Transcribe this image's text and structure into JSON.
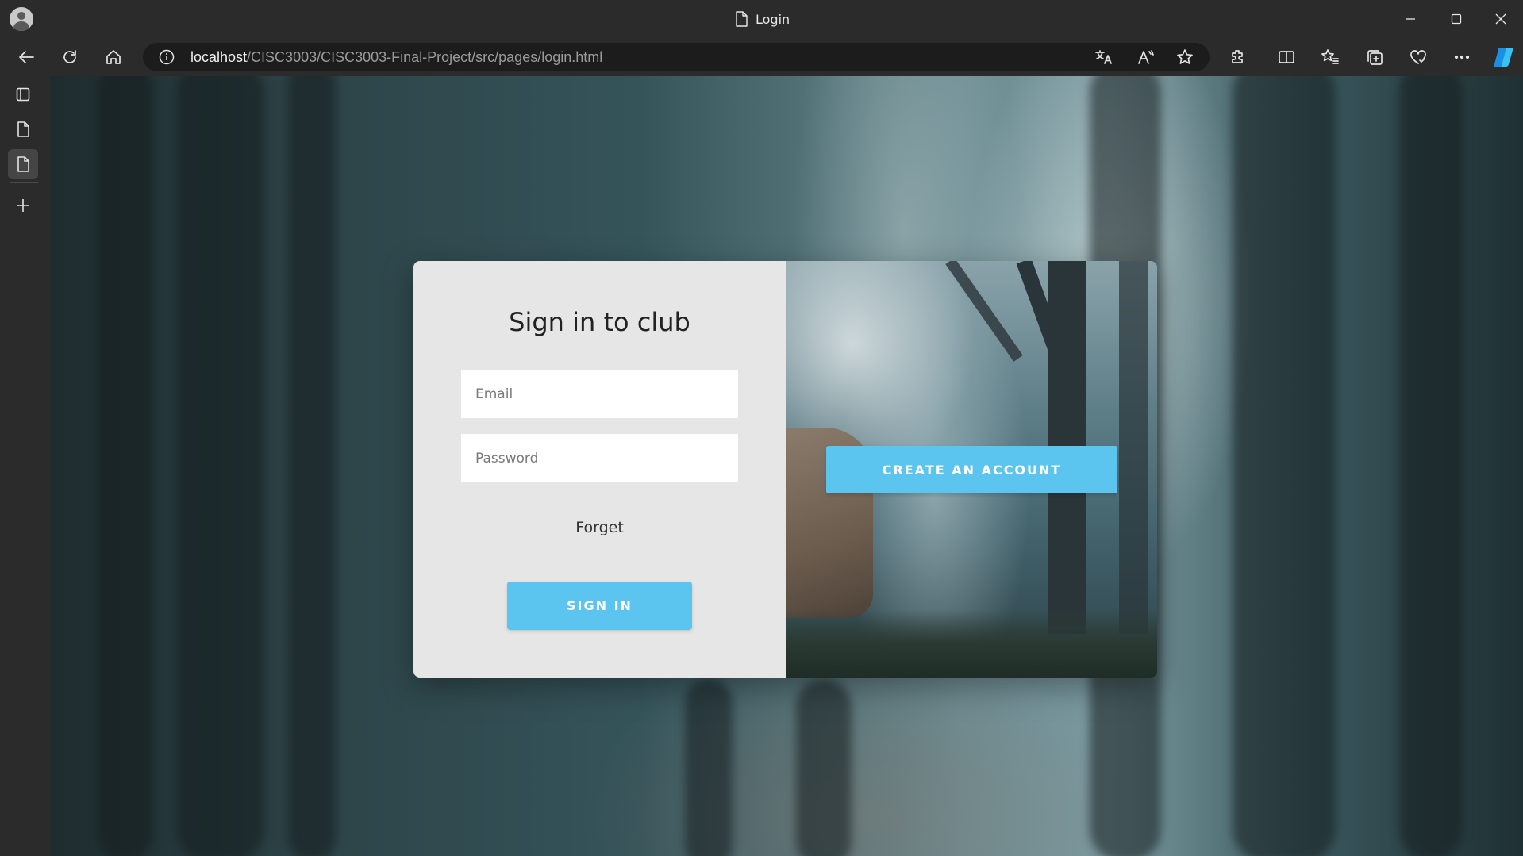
{
  "window": {
    "tab_title": "Login"
  },
  "toolbar": {
    "url_host": "localhost",
    "url_path": "/CISC3003/CISC3003-Final-Project/src/pages/login.html"
  },
  "page": {
    "signin_title": "Sign in to club",
    "email_placeholder": "Email",
    "password_placeholder": "Password",
    "forget_label": "Forget",
    "signin_button": "SIGN IN",
    "create_account_button": "CREATE AN ACCOUNT"
  },
  "colors": {
    "accent": "#5bc5ef",
    "card_bg": "#e6e6e6",
    "chrome_bg": "#2b2b2b"
  },
  "icons": [
    "profile-icon",
    "page-icon",
    "minimize-icon",
    "maximize-icon",
    "close-icon",
    "back-icon",
    "refresh-icon",
    "home-icon",
    "info-icon",
    "translate-icon",
    "read-aloud-icon",
    "favorite-star-icon",
    "extensions-icon",
    "split-screen-icon",
    "favorites-icon",
    "collections-icon",
    "browser-essentials-icon",
    "more-icon",
    "copilot-icon",
    "tab-actions-icon",
    "sidebar-page-icon",
    "add-icon"
  ]
}
